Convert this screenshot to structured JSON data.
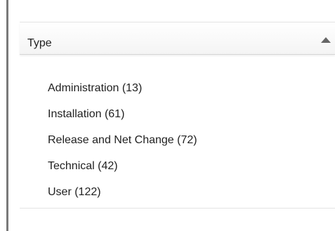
{
  "facet": {
    "title": "Type",
    "collapse_icon": "triangle-up-icon",
    "items": [
      {
        "label": "Administration",
        "count": "(13)",
        "text": "Administration (13)"
      },
      {
        "label": "Installation",
        "count": "(61)",
        "text": "Installation (61)"
      },
      {
        "label": "Release and Net Change",
        "count": "(72)",
        "text": "Release and Net Change (72)"
      },
      {
        "label": "Technical",
        "count": "(42)",
        "text": "Technical (42)"
      },
      {
        "label": "User",
        "count": "(122)",
        "text": "User (122)"
      }
    ]
  },
  "colors": {
    "text": "#1f1f1f",
    "rule": "#7a7a7a",
    "header_border": "#d6d6d6"
  }
}
